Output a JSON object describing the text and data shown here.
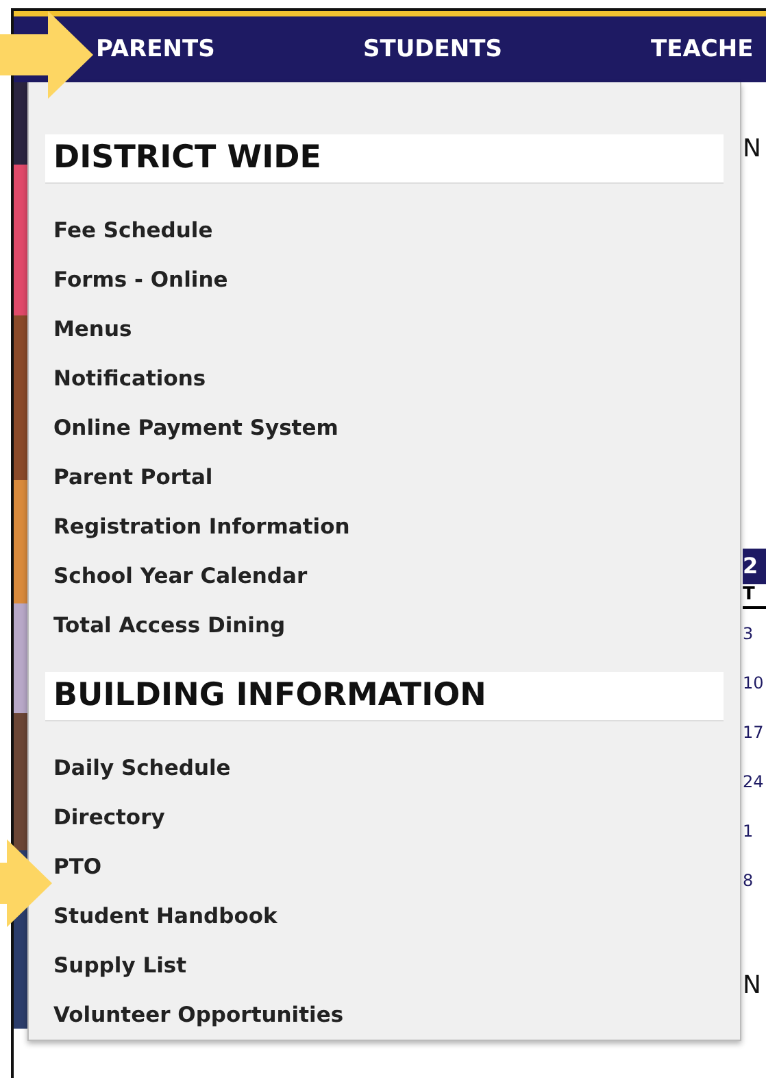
{
  "nav": {
    "items": [
      {
        "label": "PARENTS"
      },
      {
        "label": "STUDENTS"
      },
      {
        "label": "TEACHE"
      }
    ]
  },
  "menu": {
    "sections": [
      {
        "heading": "DISTRICT WIDE",
        "items": [
          "Fee Schedule",
          "Forms - Online",
          "Menus",
          "Notifications",
          "Online Payment System",
          "Parent Portal",
          "Registration Information",
          "School Year Calendar",
          "Total Access Dining"
        ]
      },
      {
        "heading": "BUILDING INFORMATION",
        "items": [
          "Daily Schedule",
          "Directory",
          "PTO",
          "Student Handbook",
          "Supply List",
          "Volunteer Opportunities"
        ]
      }
    ]
  },
  "background": {
    "heading_fragment": "N",
    "calendar_header": "2",
    "column_header": "T",
    "dates": [
      "3",
      "10",
      "17",
      "24",
      "1",
      "8"
    ],
    "footer_fragment": "N"
  }
}
